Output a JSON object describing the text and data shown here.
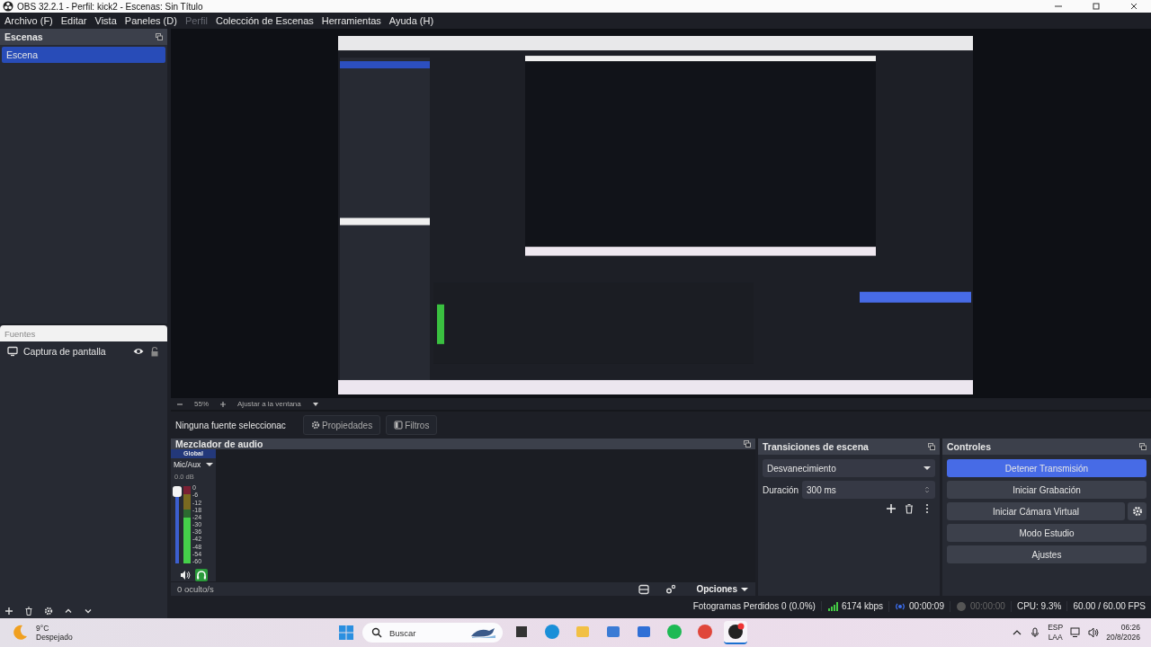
{
  "window": {
    "title": "OBS 32.2.1 - Perfil: kick2 - Escenas: Sin Título"
  },
  "menu": [
    {
      "label": "Archivo (F)",
      "disabled": false
    },
    {
      "label": "Editar",
      "disabled": false
    },
    {
      "label": "Vista",
      "disabled": false
    },
    {
      "label": "Paneles (D)",
      "disabled": false
    },
    {
      "label": "Perfil",
      "disabled": true
    },
    {
      "label": "Colección de Escenas",
      "disabled": false
    },
    {
      "label": "Herramientas",
      "disabled": false
    },
    {
      "label": "Ayuda (H)",
      "disabled": false
    }
  ],
  "scenes": {
    "title": "Escenas",
    "items": [
      {
        "label": "Escena",
        "selected": true
      }
    ]
  },
  "sources": {
    "title": "Fuentes",
    "items": [
      {
        "label": "Captura de pantalla",
        "visible": true,
        "locked": false
      }
    ]
  },
  "preview": {
    "kind": "picture",
    "zoom": "55%",
    "fit": "Ajustar a la ventana"
  },
  "source_bar": {
    "label": "Ninguna fuente seleccionac",
    "properties": "Propiedades",
    "filters": "Filtros"
  },
  "mixer": {
    "title": "Mezclador de audio",
    "tab": "Global",
    "channel": "Mic/Aux",
    "volume": "0.0 dB",
    "fader": {
      "level": 1
    },
    "meter": {
      "level": 0.6
    },
    "scale": [
      "0",
      "-6",
      "-12",
      "-18",
      "-24",
      "-30",
      "-36",
      "-42",
      "-48",
      "-54",
      "-60"
    ],
    "muted": false,
    "monitoring": true,
    "hidden": "0 oculto/s",
    "options": "Opciones"
  },
  "transitions": {
    "title": "Transiciones de escena",
    "transition": "Desvanecimiento",
    "duration_label": "Duración",
    "duration": "300 ms"
  },
  "controls": {
    "title": "Controles",
    "buttons": [
      {
        "label": "Detener Transmisión",
        "active": true,
        "settings": false
      },
      {
        "label": "Iniciar Grabación",
        "active": false,
        "settings": false
      },
      {
        "label": "Iniciar Cámara Virtual",
        "active": false,
        "settings": true
      },
      {
        "label": "Modo Estudio",
        "active": false,
        "settings": false
      },
      {
        "label": "Ajustes",
        "active": false,
        "settings": false
      }
    ]
  },
  "status": {
    "dropped": "Fotogramas Perdidos 0 (0.0%)",
    "bitrate": "6174 kbps",
    "streaming": true,
    "stream_time": "00:00:09",
    "recording": false,
    "record_time": "00:00:00",
    "cpu": "CPU: 9.3%",
    "fps": "60.00 / 60.00 FPS"
  },
  "taskbar": {
    "temperature": "9°C",
    "weather": "Despejado",
    "search": "Buscar",
    "apps": [
      {
        "kind": "task-view",
        "selected": false
      },
      {
        "kind": "browser",
        "selected": false
      },
      {
        "kind": "folder",
        "selected": false
      },
      {
        "kind": "store",
        "selected": false
      },
      {
        "kind": "mail",
        "selected": false
      },
      {
        "kind": "music",
        "selected": false
      },
      {
        "kind": "chrome",
        "selected": false
      },
      {
        "kind": "obs",
        "selected": true
      }
    ],
    "language": "ESP",
    "layout": "LAA",
    "time": "06:26",
    "date": "20/8/2026"
  }
}
